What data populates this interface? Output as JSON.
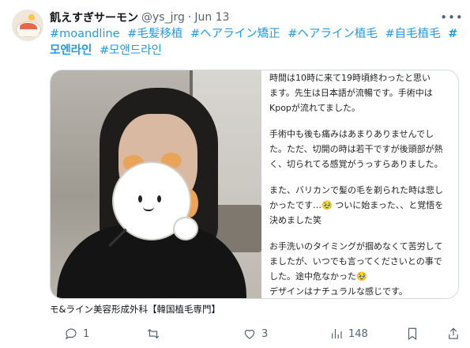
{
  "tweet": {
    "author": {
      "display_name": "飢えすぎサーモン",
      "handle": "@ys_jrg",
      "date": "Jun 13"
    },
    "hashtags": [
      {
        "text": "#moandline",
        "bold": false
      },
      {
        "text": "#毛髪移植",
        "bold": false
      },
      {
        "text": "#ヘアライン矯正",
        "bold": false
      },
      {
        "text": "#ヘアライン植毛",
        "bold": false
      },
      {
        "text": "#自毛植毛",
        "bold": false
      },
      {
        "text": "#모엔라인",
        "bold": true
      },
      {
        "text": "#모앤드라인",
        "bold": false
      }
    ],
    "media": {
      "text_lines": [
        "時間は10時に来て19時頃終わったと思い",
        "ます。先生は日本語が流暢です。手術中は",
        "Kpopが流れてました。",
        "",
        "手術中も後も痛みはあまりありませんでし",
        "た。ただ、切開の時は若干ですが後頭部が熱",
        "く、切られてる感覚がうっすらありました。",
        "",
        "また、バリカンで髪の毛を剃られた時は悲し",
        "かったです…🥹 ついに始まった、、と覚悟を",
        "決めました笑",
        "",
        "お手洗いのタイミングが掴めなくて苦労して",
        "ましたが、いつでも言ってくださいとの事で",
        "した。途中危なかった🥹",
        "デザインはナチュラルな感じです。"
      ]
    },
    "caption": "モ&ライン美容形成外科【韓国植毛専門】",
    "actions": {
      "reply_count": "1",
      "retweet_count": "",
      "like_count": "3",
      "view_count": "148"
    },
    "icons": {
      "more": "more-icon",
      "reply": "reply-icon",
      "retweet": "retweet-icon",
      "like": "heart-icon",
      "views": "views-icon",
      "bookmark": "bookmark-icon",
      "share": "share-icon"
    },
    "colors": {
      "link": "#1d9bf0",
      "muted": "#536471",
      "text": "#0f1419"
    }
  }
}
